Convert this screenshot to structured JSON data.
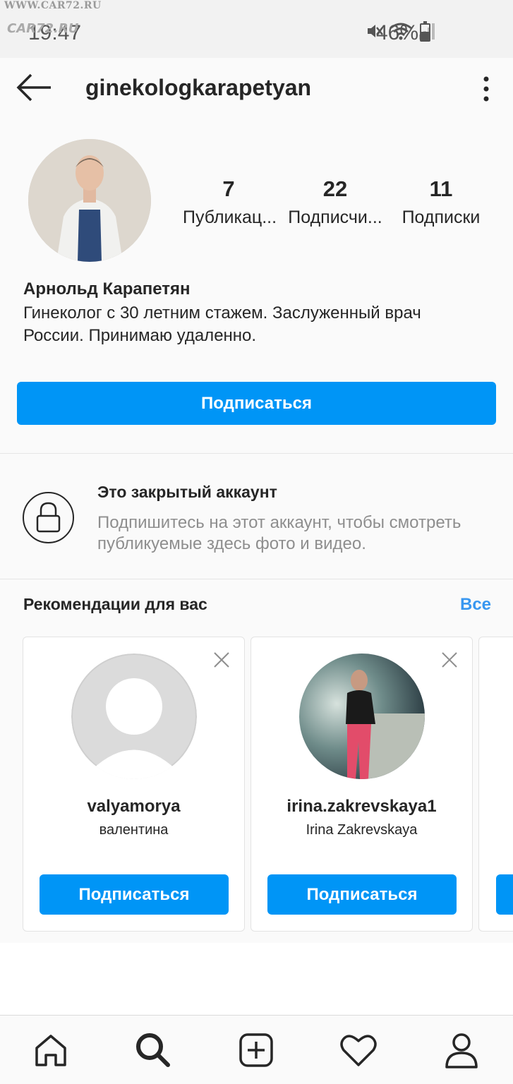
{
  "status_bar": {
    "watermark_url": "WWW.CAR72.RU",
    "watermark_logo": "CAR72.RU",
    "time": "19:47",
    "battery": "46%",
    "icons": [
      "mute-icon",
      "wifi-icon",
      "signal-icon",
      "battery-icon"
    ]
  },
  "header": {
    "username": "ginekologkarapetyan",
    "back_icon": "arrow-left-icon",
    "more_icon": "more-vertical-icon"
  },
  "profile": {
    "stats": [
      {
        "value": "7",
        "label": "Публикац..."
      },
      {
        "value": "22",
        "label": "Подписчи..."
      },
      {
        "value": "11",
        "label": "Подписки"
      }
    ],
    "full_name": "Арнольд Карапетян",
    "bio": "Гинеколог с 30 летним стажем. Заслуженный врач России. Принимаю удаленно.",
    "follow_label": "Подписаться"
  },
  "private": {
    "title": "Это закрытый аккаунт",
    "text": "Подпишитесь на этот аккаунт, чтобы смотреть публикуемые здесь фото и видео.",
    "icon": "lock-icon"
  },
  "recommendations": {
    "title": "Рекомендации для вас",
    "see_all": "Все",
    "cards": [
      {
        "username": "valyamorya",
        "name": "валентина",
        "follow_label": "Подписаться",
        "avatar": "default-avatar"
      },
      {
        "username": "irina.zakrevskaya1",
        "name": "Irina  Zakrevskaya",
        "follow_label": "Подписаться",
        "avatar": "photo-avatar"
      }
    ]
  },
  "bottom_nav": {
    "items": [
      "home-icon",
      "search-icon",
      "add-icon",
      "heart-icon",
      "profile-icon"
    ]
  },
  "colors": {
    "accent": "#0095f6",
    "link": "#3897f0",
    "text": "#262626",
    "muted": "#8e8e8e"
  }
}
